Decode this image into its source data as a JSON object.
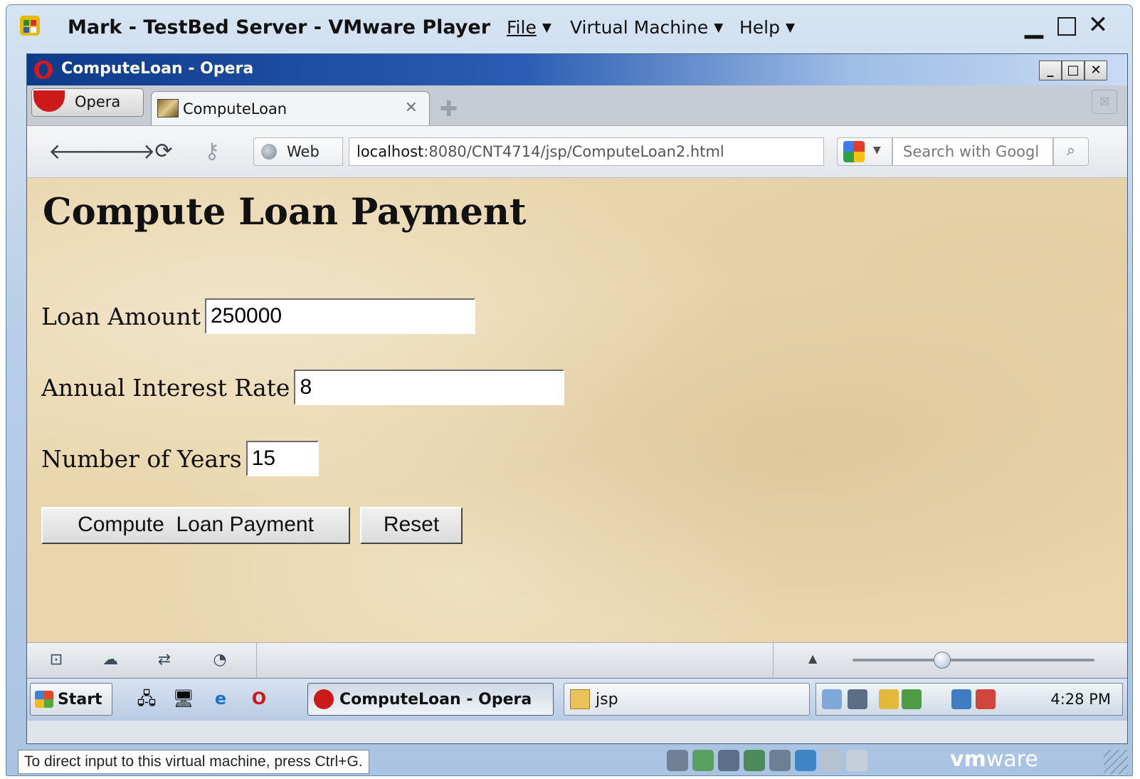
{
  "vmware": {
    "title": "Mark - TestBed Server - VMware Player",
    "menus": [
      {
        "label": "File"
      },
      {
        "label": "Virtual Machine"
      },
      {
        "label": "Help"
      }
    ],
    "hint": "To direct input to this virtual machine, press Ctrl+G.",
    "logo_bold": "vm",
    "logo_rest": "ware"
  },
  "opera": {
    "window_title": "ComputeLoan - Opera",
    "menu_label": "Opera",
    "tab_label": "ComputeLoan",
    "web_label": "Web",
    "address_host": "localhost",
    "address_path": ":8080/CNT4714/jsp/ComputeLoan2.html",
    "search_placeholder": "Search with Googl"
  },
  "page": {
    "heading": "Compute Loan Payment",
    "loan_amount_label": "Loan Amount",
    "loan_amount_value": "250000",
    "interest_label": "Annual Interest Rate",
    "interest_value": "8",
    "years_label": "Number of Years",
    "years_value": "15",
    "compute_button": "Compute  Loan Payment",
    "reset_button": "Reset"
  },
  "taskbar": {
    "start_label": "Start",
    "tasks": [
      {
        "label": "ComputeLoan - Opera"
      },
      {
        "label": "jsp"
      }
    ],
    "clock": "4:28 PM"
  },
  "colors": {
    "page_background": "#e9d6ad",
    "opera_red": "#cc1a1a",
    "title_gradient_start": "#0e3a8a"
  }
}
